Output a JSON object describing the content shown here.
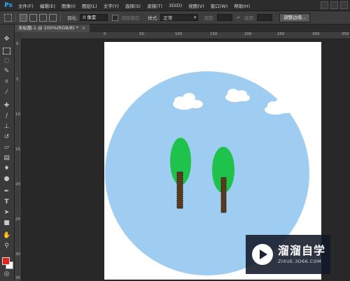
{
  "app": {
    "logo_text": "Ps"
  },
  "menubar": {
    "items": [
      "文件(F)",
      "编辑(E)",
      "图像(I)",
      "图层(L)",
      "文字(Y)",
      "选择(S)",
      "滤镜(T)",
      "3D(D)",
      "视图(V)",
      "窗口(W)",
      "帮助(H)"
    ]
  },
  "options_bar": {
    "feather_label": "羽化:",
    "feather_value": "0 像素",
    "antialias_label": "消除锯齿",
    "style_label": "样式:",
    "style_value": "正常",
    "width_label": "宽度:",
    "height_label": "高度:",
    "refine_edge_button": "调整边缘..."
  },
  "document_tab": {
    "title": "未标题-1 @ 100%(RGB/8) *",
    "close_glyph": "×"
  },
  "ruler": {
    "h_labels": [
      "0",
      "50",
      "100",
      "150",
      "200",
      "250",
      "300",
      "350"
    ],
    "v_labels": [
      "0",
      "5",
      "10",
      "15",
      "20",
      "25",
      "30",
      "35"
    ]
  },
  "colors": {
    "foreground": "#e3231c",
    "background": "#ffffff",
    "sky_circle": "#9ecdf1",
    "tree_crown": "#1fc24a",
    "tree_trunk": "#5a3a1e"
  },
  "watermark": {
    "title": "溜溜自学",
    "url": "ZIXUE.3D66.COM"
  }
}
